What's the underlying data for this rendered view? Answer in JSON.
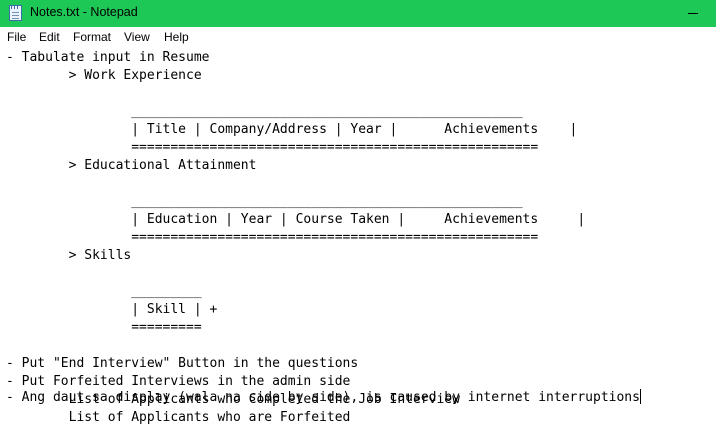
{
  "window": {
    "title": "Notes.txt - Notepad"
  },
  "menu": [
    "File",
    "Edit",
    "Format",
    "View",
    "Help"
  ],
  "editor": {
    "lines": [
      "- Tabulate input in Resume",
      "        > Work Experience",
      "",
      "                __________________________________________________",
      "                | Title | Company/Address | Year |      Achievements    |",
      "                ====================================================",
      "        > Educational Attainment",
      "",
      "                __________________________________________________",
      "                | Education | Year | Course Taken |     Achievements     |",
      "                ====================================================",
      "        > Skills",
      "",
      "                _________",
      "                | Skill | +",
      "                =========",
      "",
      "- Put \"End Interview\" Button in the questions",
      "- Put Forfeited Interviews in the admin side",
      "        List of Applicants who Completed the Job Interview",
      "        List of Applicants who are Forfeited",
      "",
      "- Ang daut sa display (wala na side by side), is caused by internet interruptions"
    ]
  },
  "colors": {
    "titlebar": "#1ec856",
    "text": "#000000",
    "background": "#ffffff"
  }
}
